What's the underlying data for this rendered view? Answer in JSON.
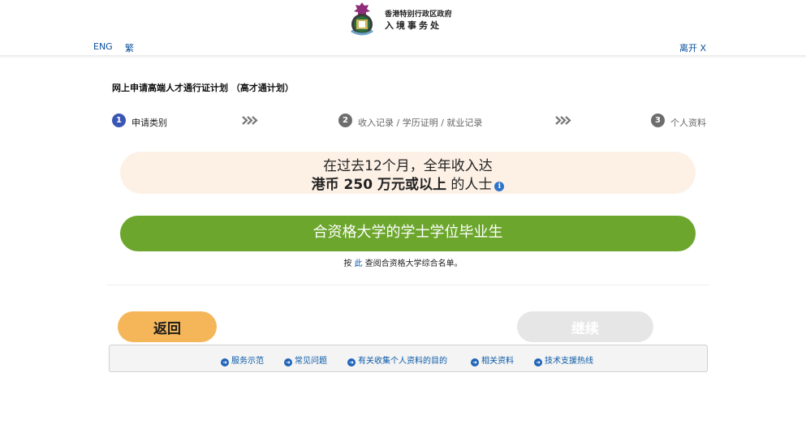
{
  "header": {
    "logo_icon": "hksar-immigration-emblem-icon",
    "dept_line1": "香港特别行政区政府",
    "dept_line2": "入境事务处",
    "lang_eng": "ENG",
    "lang_trad": "繁",
    "leave": "离开 X"
  },
  "page_title": "网上申请高端人才通行证计划 （高才通计划）",
  "steps": [
    {
      "number": "1",
      "label": "申请类别",
      "active": true
    },
    {
      "number": "2",
      "label": "收入记录 / 学历证明 / 就业记录",
      "active": false
    },
    {
      "number": "3",
      "label": "个人资料",
      "active": false
    }
  ],
  "options": {
    "income_line1": "在过去12个月，全年收入达",
    "income_bold": "港币 250 万元或以上",
    "income_suffix": " 的人士",
    "income_info_icon": "info-icon",
    "degree": "合资格大学的学士学位毕业生"
  },
  "note": {
    "prefix": "按 ",
    "link": "此",
    "suffix": " 查阅合资格大学综合名单。"
  },
  "buttons": {
    "back": "返回",
    "next": "继续"
  },
  "footer": {
    "links": [
      "服务示范",
      "常见问题",
      "有关收集个人资料的目的",
      "相关资料",
      "技术支援热线"
    ],
    "icon": "arrow-circle-right-icon"
  },
  "colors": {
    "step_active": "#3a56b5",
    "step_inactive": "#6d6d6d",
    "income_bg": "#fdf1e6",
    "degree_bg": "#6ca62d",
    "back_bg": "#f5b65a",
    "next_bg_disabled": "#e6e6e6",
    "link": "#0b5aa8"
  }
}
